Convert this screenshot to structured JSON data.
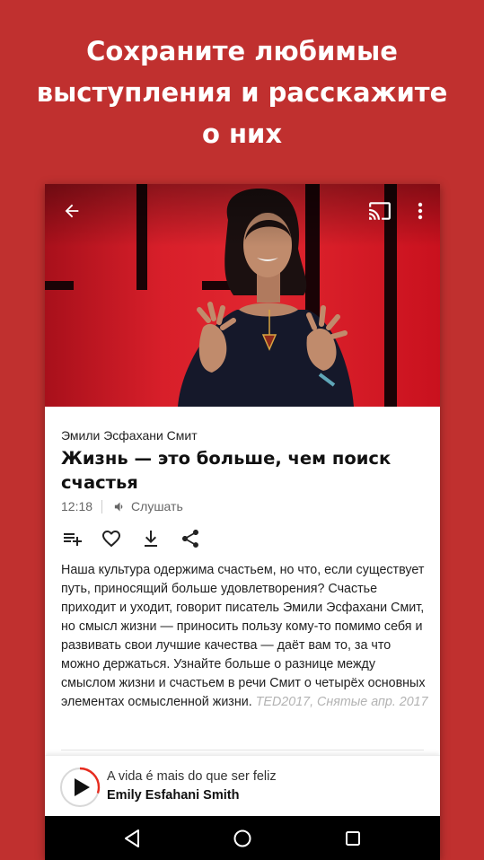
{
  "promo": {
    "line1": "Сохраните любимые",
    "line2": "выступления и расскажите",
    "line3": "о них"
  },
  "header": {
    "back_icon": "arrow-back-icon",
    "cast_icon": "cast-icon",
    "more_icon": "more-vert-icon"
  },
  "talk": {
    "speaker": "Эмили Эсфахани Смит",
    "title": "Жизнь — это больше, чем поиск счастья",
    "duration": "12:18",
    "listen_label": "Слушать",
    "description": "Наша культура одержима счастьем, но что, если существует путь, приносящий больше удовлетворения? Счастье приходит и уходит, говорит писатель Эмили Эсфахани Смит, но смысл жизни — приносить пользу кому-то помимо себя и развивать свои лучшие качества — даёт вам то, за что можно держаться. Узнайте больше о разнице между смыслом жизни и счастьем в речи Смит о четырёх основных элементах осмысленной жизни.",
    "event_meta": "TED2017, Снятые апр. 2017"
  },
  "actions": [
    "playlist-add-icon",
    "heart-icon",
    "download-icon",
    "share-icon"
  ],
  "player": {
    "track": "A vida é mais do que ser feliz",
    "speaker": "Emily Esfahani Smith",
    "progress": 0.3
  },
  "colors": {
    "brand": "#c0302f",
    "accent": "#e62b1e"
  }
}
